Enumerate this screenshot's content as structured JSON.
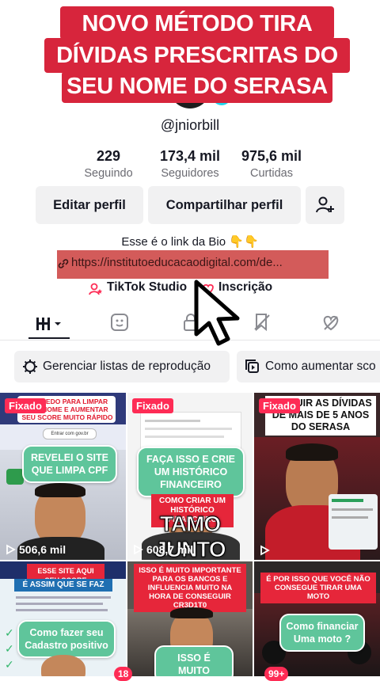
{
  "overlay": {
    "line1": "NOVO MÉTODO TIRA",
    "line2": "DÍVIDAS PRESCRITAS DO",
    "line3": "SEU NOME DO SERASA",
    "color": "#d7253c"
  },
  "profile": {
    "username": "@jniorbill",
    "stats": [
      {
        "value": "229",
        "label": "Seguindo"
      },
      {
        "value": "173,4 mil",
        "label": "Seguidores"
      },
      {
        "value": "975,6 mil",
        "label": "Curtidas"
      }
    ],
    "buttons": {
      "edit": "Editar perfil",
      "share": "Compartilhar perfil",
      "add_friend_icon": "person-plus-icon"
    },
    "bio": "Esse é o link da Bio 👇👇",
    "link": "https://institutoeducacaodigital.com/de...",
    "tiktok_studio": "TikTok Studio",
    "subscription": "Inscrição"
  },
  "tabs": [
    {
      "icon": "grid-icon",
      "active": true
    },
    {
      "icon": "sticker-icon",
      "active": false
    },
    {
      "icon": "lock-icon",
      "active": false
    },
    {
      "icon": "bookmark-icon",
      "active": false
    },
    {
      "icon": "liked-heart-icon",
      "active": false
    }
  ],
  "pills": {
    "playlists": "Gerenciar listas de reprodução",
    "grow": "Como aumentar sco"
  },
  "videos": [
    {
      "pinned": "Fixado",
      "top_text": "SEGREDO PARA LIMPAR SEU NOME E AUMENTAR SEU SCORE MUITO RÁPIDO",
      "bubble": "REVELEI O SITE QUE LIMPA CPF",
      "views": "506,6 mil",
      "extra": "Entrar com gov.br"
    },
    {
      "pinned": "Fixado",
      "bubble": "FAÇA ISSO E CRIE UM HISTÓRICO FINANCEIRO",
      "redtag": "COMO CRIAR UM HISTÓRICO FINANCEIRO",
      "big_text": "TAMO JUNTO",
      "views": "608,7 mil"
    },
    {
      "pinned": "Fixado",
      "top_text": "EXCLUIR AS DÍVIDAS DE MAIS DE 5 ANOS DO SERASA",
      "views": ""
    },
    {
      "top_tag": "ESSE SITE AQUI SEU SCORE",
      "banner": "É ASSIM QUE SE FAZ",
      "bubble": "Como fazer seu Cadastro positivo"
    },
    {
      "redtag": "ISSO É MUITO IMPORTANTE PARA OS BANCOS E INFLUENCIA MUITO NA HORA DE CONSEGUIR CR3D1T0",
      "bubble": "ISSO É MUITO"
    },
    {
      "redtag": "É POR ISSO QUE VOCÊ NÃO CONSEGUE TIRAR UMA MOTO",
      "bubble": "Como financiar Uma moto ?"
    }
  ],
  "bottom_badges": [
    "18",
    "99+"
  ],
  "cursor_icon": "mouse-pointer-icon",
  "colors": {
    "accent": "#fe2c55",
    "link_highlight": "#d35b5a",
    "bubble_green": "#5fc59b"
  }
}
